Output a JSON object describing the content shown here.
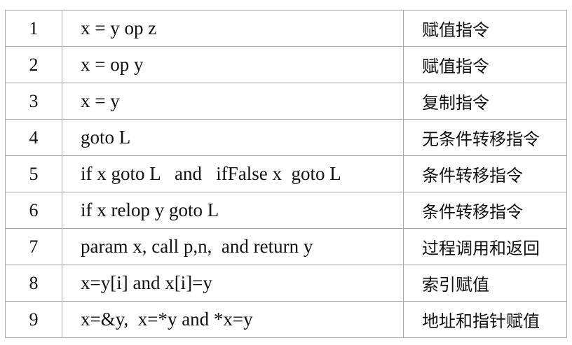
{
  "table": {
    "rows": [
      {
        "num": "1",
        "instruction": "x = y op z",
        "description": "赋值指令"
      },
      {
        "num": "2",
        "instruction": "x = op y",
        "description": "赋值指令"
      },
      {
        "num": "3",
        "instruction": "x = y",
        "description": "复制指令"
      },
      {
        "num": "4",
        "instruction": "goto L",
        "description": "无条件转移指令"
      },
      {
        "num": "5",
        "instruction": "if x goto L   and   ifFalse x  goto L",
        "description": "条件转移指令"
      },
      {
        "num": "6",
        "instruction": "if x relop y goto L",
        "description": "条件转移指令"
      },
      {
        "num": "7",
        "instruction": "param x, call p,n,  and return y",
        "description": "过程调用和返回"
      },
      {
        "num": "8",
        "instruction": "x=y[i] and x[i]=y",
        "description": "索引赋值"
      },
      {
        "num": "9",
        "instruction": "x=&y,  x=*y and *x=y",
        "description": "地址和指针赋值"
      }
    ]
  }
}
